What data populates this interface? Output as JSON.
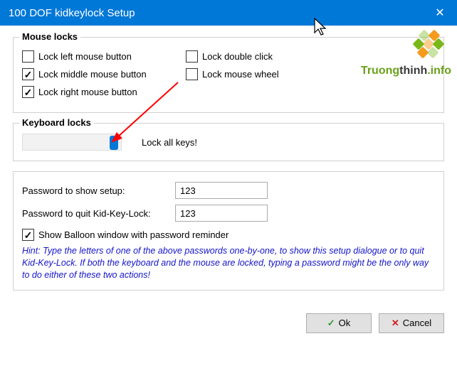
{
  "window": {
    "title": "100 DOF kidkeylock Setup"
  },
  "mouse": {
    "group_title": "Mouse locks",
    "lock_left_label": "Lock left mouse button",
    "lock_left_checked": false,
    "lock_middle_label": "Lock middle mouse button",
    "lock_middle_checked": true,
    "lock_right_label": "Lock right mouse button",
    "lock_right_checked": true,
    "lock_double_label": "Lock double click",
    "lock_double_checked": false,
    "lock_wheel_label": "Lock mouse wheel",
    "lock_wheel_checked": false
  },
  "keyboard": {
    "group_title": "Keyboard locks",
    "slider_label": "Lock all keys!"
  },
  "passwords": {
    "show_label": "Password to show setup:",
    "show_value": "123",
    "quit_label": "Password to quit Kid-Key-Lock:",
    "quit_value": "123",
    "balloon_label": "Show Balloon window with password reminder",
    "balloon_checked": true,
    "hint": "Hint: Type the letters of one of the above passwords one-by-one, to show this setup dialogue or to quit Kid-Key-Lock. If both the keyboard and the mouse are locked, typing a password might be the only way to do either of these two actions!"
  },
  "buttons": {
    "ok": "Ok",
    "cancel": "Cancel"
  },
  "watermark": {
    "part1": "Truong",
    "part2": "thinh",
    "part3": ".info"
  }
}
